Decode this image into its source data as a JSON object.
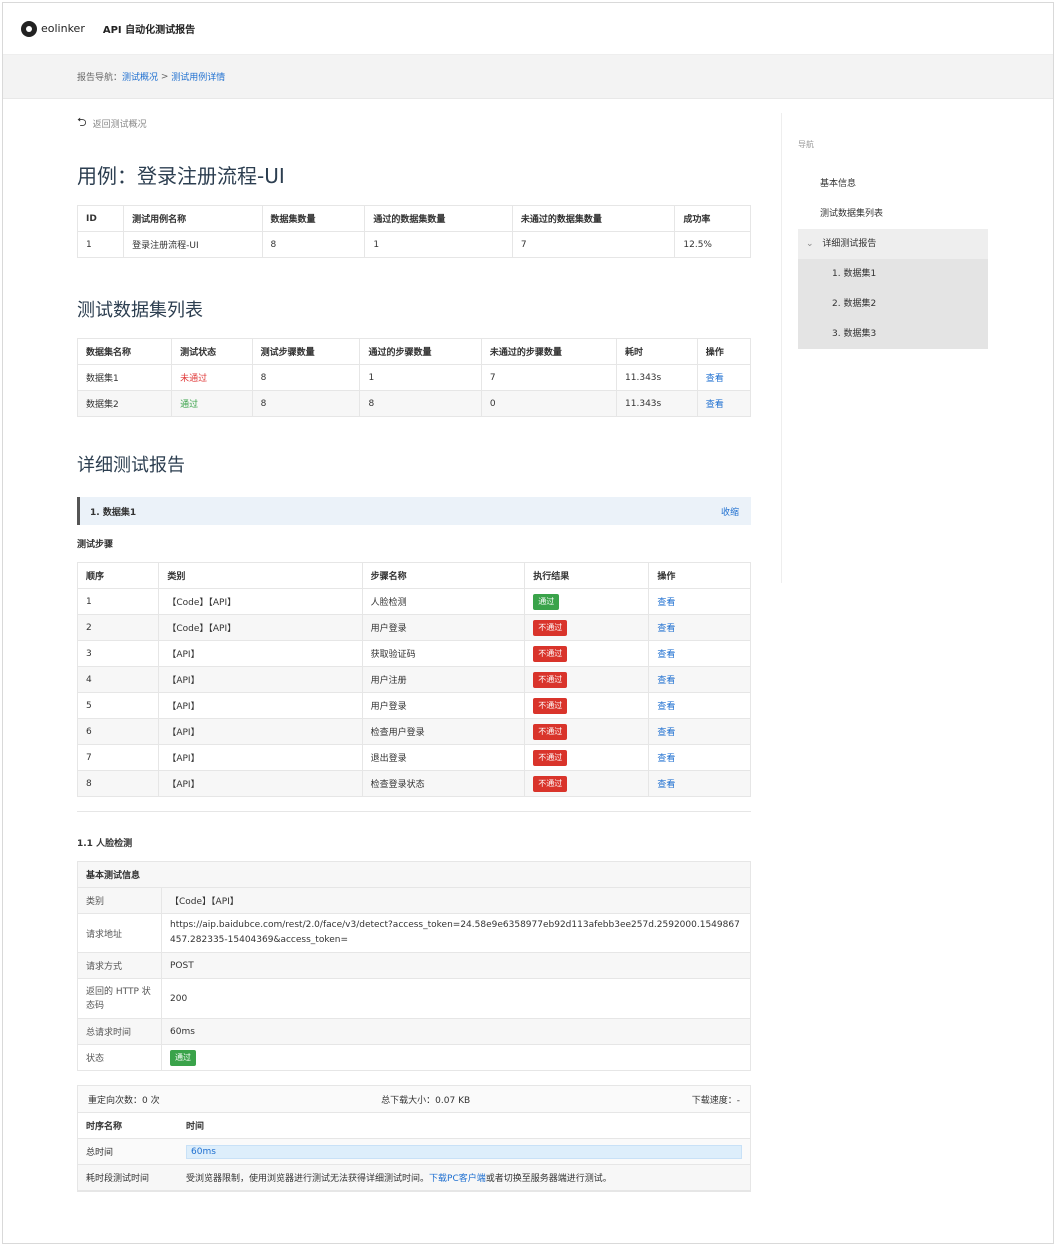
{
  "header": {
    "logo_text": "eolinker",
    "app_title": "API 自动化测试报告"
  },
  "nav": {
    "prefix": "报告导航：",
    "crumb1": "测试概况",
    "sep": " > ",
    "crumb2": "测试用例详情"
  },
  "back": {
    "icon": "⮌",
    "label": "返回测试概况"
  },
  "case": {
    "title": "用例：登录注册流程-UI",
    "headers": [
      "ID",
      "测试用例名称",
      "数据集数量",
      "通过的数据集数量",
      "未通过的数据集数量",
      "成功率"
    ],
    "row": [
      "1",
      "登录注册流程-UI",
      "8",
      "1",
      "7",
      "12.5%"
    ]
  },
  "datasets": {
    "title": "测试数据集列表",
    "headers": [
      "数据集名称",
      "测试状态",
      "测试步骤数量",
      "通过的步骤数量",
      "未通过的步骤数量",
      "耗时",
      "操作"
    ],
    "rows": [
      {
        "name": "数据集1",
        "status": "未通过",
        "steps": "8",
        "passed": "1",
        "failed": "7",
        "time": "11.343s",
        "op": "查看"
      },
      {
        "name": "数据集2",
        "status": "通过",
        "steps": "8",
        "passed": "8",
        "failed": "0",
        "time": "11.343s",
        "op": "查看"
      }
    ]
  },
  "detail": {
    "title": "详细测试报告",
    "dataset_head": "1. 数据集1",
    "collapse": "收缩",
    "steps_label": "测试步骤",
    "headers": [
      "顺序",
      "类别",
      "步骤名称",
      "执行结果",
      "操作"
    ],
    "rows": [
      {
        "order": "1",
        "type": "【Code】【API】",
        "name": "人脸检测",
        "result": "通过",
        "op": "查看"
      },
      {
        "order": "2",
        "type": "【Code】【API】",
        "name": "用户登录",
        "result": "不通过",
        "op": "查看"
      },
      {
        "order": "3",
        "type": "【API】",
        "name": "获取验证码",
        "result": "不通过",
        "op": "查看"
      },
      {
        "order": "4",
        "type": "【API】",
        "name": "用户注册",
        "result": "不通过",
        "op": "查看"
      },
      {
        "order": "5",
        "type": "【API】",
        "name": "用户登录",
        "result": "不通过",
        "op": "查看"
      },
      {
        "order": "6",
        "type": "【API】",
        "name": "检查用户登录",
        "result": "不通过",
        "op": "查看"
      },
      {
        "order": "7",
        "type": "【API】",
        "name": "退出登录",
        "result": "不通过",
        "op": "查看"
      },
      {
        "order": "8",
        "type": "【API】",
        "name": "检查登录状态",
        "result": "不通过",
        "op": "查看"
      }
    ]
  },
  "step": {
    "title": "1.1 人脸检测",
    "info_header": "基本测试信息",
    "type_label": "类别",
    "type_value": "【Code】【API】",
    "url_label": "请求地址",
    "url_value": "https://aip.baidubce.com/rest/2.0/face/v3/detect?access_token=24.58e9e6358977eb92d113afebb3ee257d.2592000.1549867457.282335-15404369&access_token=",
    "method_label": "请求方式",
    "method_value": "POST",
    "code_label": "返回的 HTTP 状态码",
    "code_value": "200",
    "time_label": "总请求时间",
    "time_value": "60ms",
    "status_label": "状态",
    "status_value": "通过"
  },
  "stats": {
    "redirect": "重定向次数：0 次",
    "download_size": "总下载大小：0.07 KB",
    "download_speed": "下载速度：-",
    "col1": "时序名称",
    "col2": "时间",
    "total_label": "总时间",
    "total_value": "60ms",
    "detail_label": "耗时段测试时间",
    "detail_text": "受浏览器限制，使用浏览器进行测试无法获得详细测试时间。",
    "detail_link": "下载PC客户端",
    "detail_tail": "或者切换至服务器端进行测试。"
  },
  "sidebar": {
    "label": "导航",
    "items": [
      "基本信息",
      "测试数据集列表"
    ],
    "group_icon": "⌄",
    "group": "详细测试报告",
    "sub": [
      "1. 数据集1",
      "2. 数据集2",
      "3. 数据集3"
    ]
  }
}
